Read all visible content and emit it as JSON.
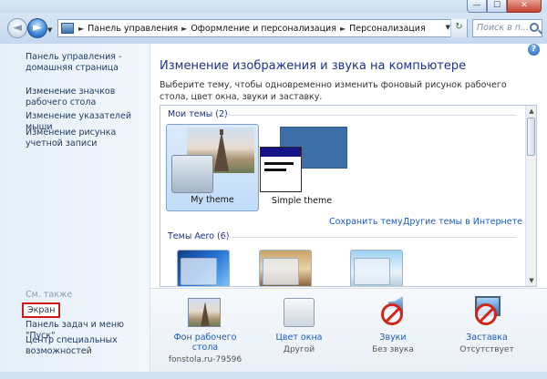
{
  "window": {
    "minimize": "—",
    "maximize": "☐",
    "close": "✕"
  },
  "nav": {
    "back_glyph": "◄",
    "forward_glyph": "►",
    "recent_glyph": "▼"
  },
  "address": {
    "root_arrow": "►",
    "segments": [
      "Панель управления",
      "Оформление и персонализация",
      "Персонализация"
    ],
    "dropdown_glyph": "▼",
    "refresh_glyph": "↻"
  },
  "search": {
    "placeholder": "Поиск в п..."
  },
  "left": {
    "home_link": "Панель управления - домашняя страница",
    "links": [
      "Изменение значков рабочего стола",
      "Изменение указателей мыши",
      "Изменение рисунка учетной записи"
    ],
    "see_also": "См. также",
    "see_also_links": [
      "Экран",
      "Панель задач и меню \"Пуск\"",
      "Центр специальных возможностей"
    ]
  },
  "main": {
    "help": "?",
    "title": "Изменение изображения и звука на компьютере",
    "description": "Выберите тему, чтобы одновременно изменить фоновый рисунок рабочего стола, цвет окна, звуки и заставку.",
    "my_themes_header": "Мои темы (2)",
    "themes": [
      {
        "name": "My theme",
        "selected": true
      },
      {
        "name": "Simple theme",
        "selected": false
      }
    ],
    "save_theme": "Сохранить тему",
    "more_themes": "Другие темы в Интернете",
    "aero_header": "Темы Aero (6)"
  },
  "bottom": [
    {
      "name": "Фон рабочего стола",
      "sub": "fonstola.ru-79596",
      "icon": "desktop-background-icon"
    },
    {
      "name": "Цвет окна",
      "sub": "Другой",
      "icon": "window-color-icon"
    },
    {
      "name": "Звуки",
      "sub": "Без звука",
      "icon": "sounds-icon"
    },
    {
      "name": "Заставка",
      "sub": "Отсутствует",
      "icon": "screensaver-icon"
    }
  ],
  "colors": {
    "link": "#1e5bb5",
    "heading": "#1e3287",
    "highlight_border": "#d21919"
  }
}
